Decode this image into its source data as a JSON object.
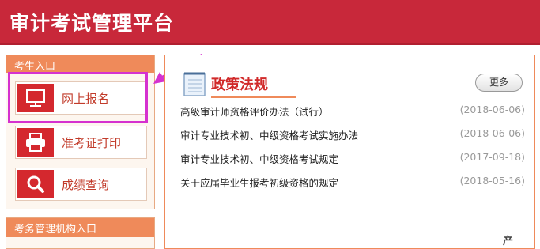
{
  "header": {
    "title": "审计考试管理平台"
  },
  "candidate_entry": {
    "heading": "考生入口",
    "buttons": [
      {
        "label": "网上报名",
        "icon": "monitor-icon"
      },
      {
        "label": "准考证打印",
        "icon": "printer-icon"
      },
      {
        "label": "成绩查询",
        "icon": "search-icon"
      }
    ]
  },
  "admin_entry": {
    "heading": "考务管理机构入口"
  },
  "policy": {
    "title": "政策法规",
    "more_label": "更多",
    "items": [
      {
        "title": "高级审计师资格评价办法（试行）",
        "date": "(2018-06-06)"
      },
      {
        "title": "审计专业技术初、中级资格考试实施办法",
        "date": "(2018-06-06)"
      },
      {
        "title": "审计专业技术初、中级资格考试规定",
        "date": "(2017-09-18)"
      },
      {
        "title": "关于应届毕业生报考初级资格的规定",
        "date": "(2018-05-16)"
      }
    ]
  },
  "colors": {
    "brand_red": "#c8283a",
    "accent_orange": "#ef8a5a",
    "highlight_magenta": "#d531cf"
  },
  "watermark": "产"
}
